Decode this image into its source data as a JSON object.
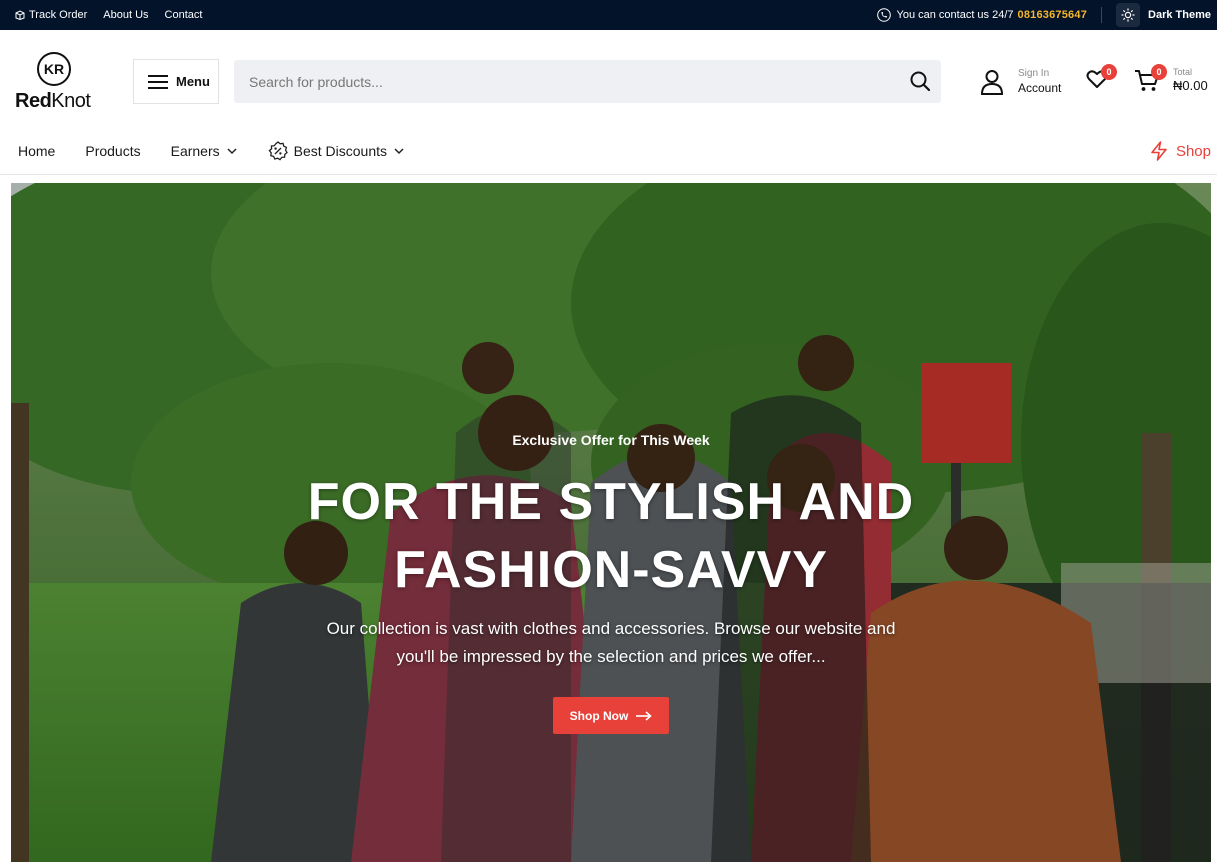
{
  "topbar": {
    "links": [
      "Track Order",
      "About Us",
      "Contact"
    ],
    "contact_label": "You can contact us 24/7",
    "contact_number": "08163675647",
    "theme_label": "Dark Theme"
  },
  "header": {
    "logo_bold": "Red",
    "logo_light": "Knot",
    "logo_mark": "KR",
    "menu_label": "Menu",
    "search_placeholder": "Search for products...",
    "account_small": "Sign In",
    "account_big": "Account",
    "wishlist_count": "0",
    "cart_count": "0",
    "total_small": "Total",
    "total_big": "₦0.00"
  },
  "nav": {
    "items": [
      "Home",
      "Products",
      "Earners",
      "Best Discounts"
    ],
    "shop_label": "Shop"
  },
  "hero": {
    "kicker": "Exclusive Offer for This Week",
    "title_line1": "FOR THE STYLISH AND",
    "title_line2": "FASHION-SAVVY",
    "description": "Our collection is vast with clothes and accessories. Browse our website and you'll be impressed by the selection and prices we offer...",
    "button_label": "Shop Now"
  },
  "colors": {
    "topbar_bg": "#03132a",
    "accent": "#e8413a",
    "contact_number": "#f6b628"
  }
}
